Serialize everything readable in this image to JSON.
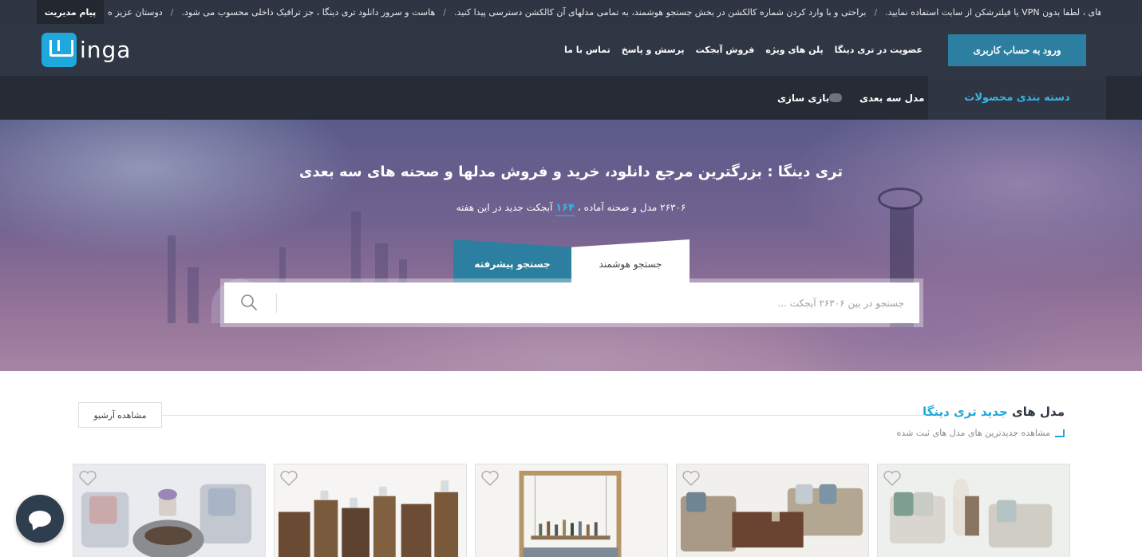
{
  "ticker": {
    "admin_label": "پیام مدیریت",
    "items": [
      "برای لود سریع آیتم های ، لطفا بدون VPN یا فیلترشکن از سایت استفاده نمایید.",
      "براحتی و با وارد کردن شماره کالکشن در بخش جستجو هوشمند، به تمامی مدلهای آن کالکشن دسترسی پیدا کنید.",
      "هاست و سرور دانلود تری دینگا ، جز ترافیک داخلی محسوب می شود.",
      "دوستان عزیز ه"
    ]
  },
  "header": {
    "logo_text": "inga",
    "nav": [
      "عضویت در تری دینگا",
      "پلن های ویژه",
      "فروش آبجکت",
      "پرسش و پاسخ",
      "تماس با ما"
    ],
    "login_label": "ورود به حساب کاربری"
  },
  "catbar": {
    "main_label": "دسته بندی محصولات",
    "links": [
      "مدل سه بعدی",
      "بازی سازی"
    ]
  },
  "hero": {
    "title": "تری دینگا : بزرگترین مرجع دانلود، خرید و فروش مدلها و صحنه های سه بعدی",
    "sub_part1": "۲۶۳۰۶ مدل و صحنه آماده ،",
    "sub_count": "۱۶۴",
    "sub_part2": "آبجکت جدید در این هفته",
    "tab_smart": "جستجو هوشمند",
    "tab_advanced": "جستجو پیشرفته",
    "search_placeholder": "جستجو در بین ۲۶۳۰۶ آبجکت ..."
  },
  "section": {
    "title_part1": "مدل های",
    "title_part2": "جدید تری دینگا",
    "subtitle": "مشاهده جدیدترین های مدل های ثبت شده",
    "archive_label": "مشاهده آرشیو"
  },
  "colors": {
    "accent": "#1fa8dc",
    "button": "#2c7fa0",
    "header_bg": "#303744",
    "catbar_bg": "#262b35"
  }
}
